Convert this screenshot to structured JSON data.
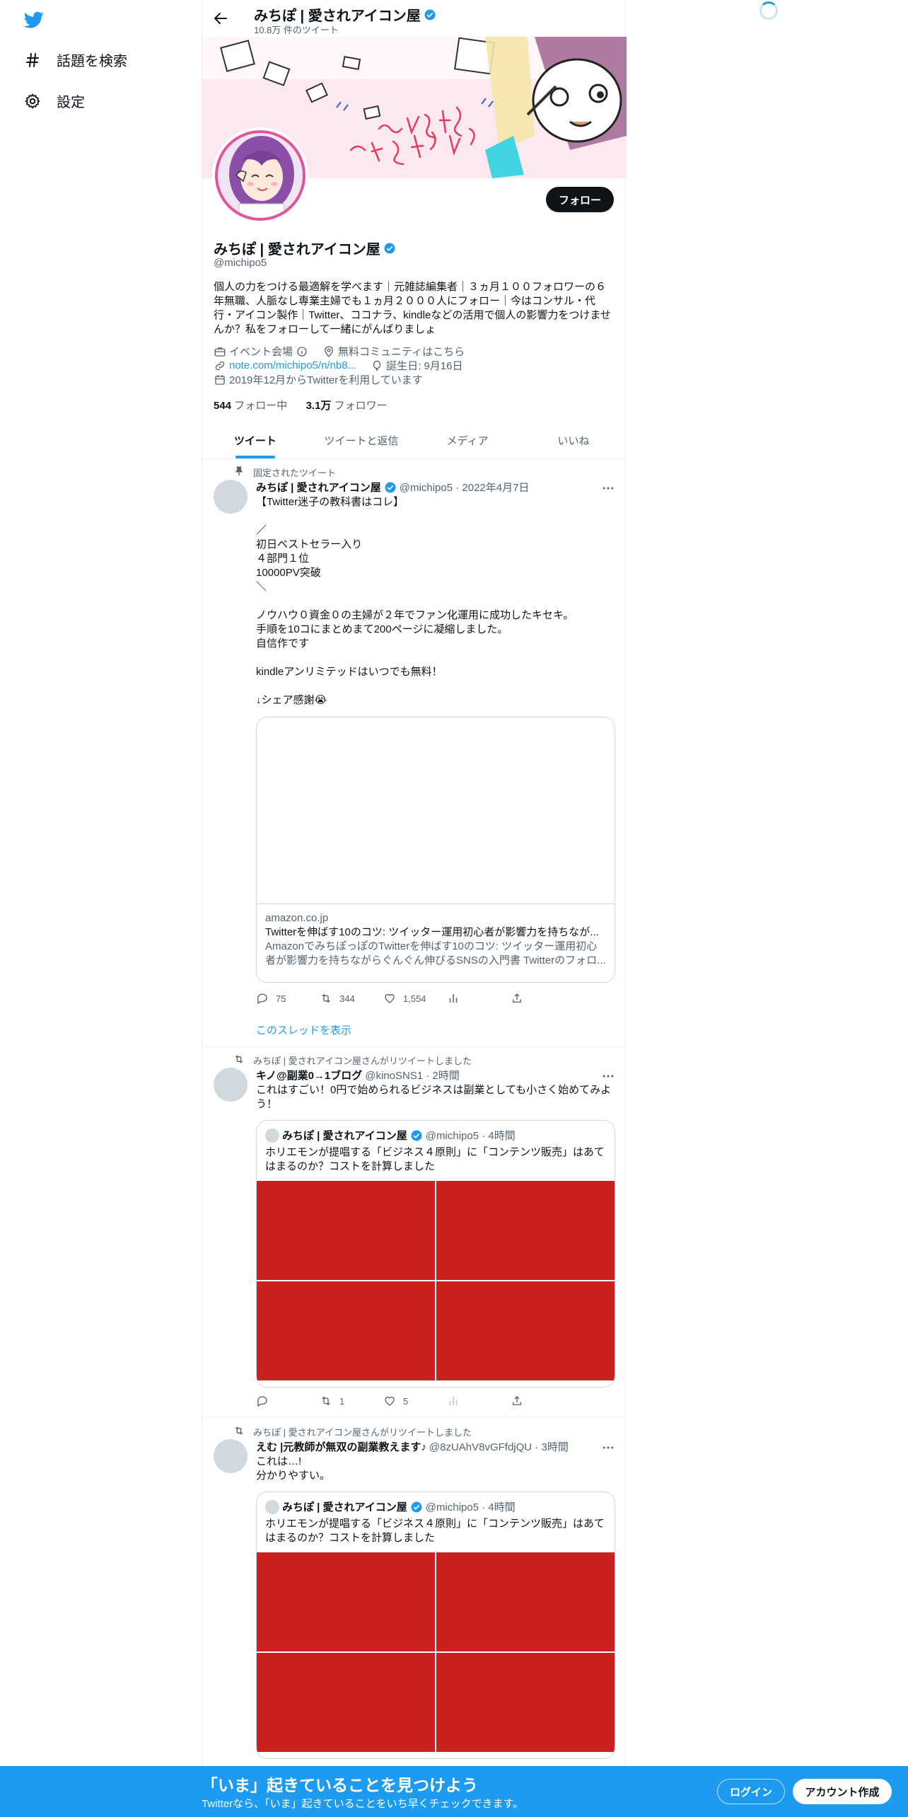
{
  "nav": {
    "explore_label": "話題を検索",
    "settings_label": "設定"
  },
  "header": {
    "name": "みちぽ | 愛されアイコン屋",
    "tweet_count": "10.8万 件のツイート"
  },
  "profile": {
    "name": "みちぽ | 愛されアイコン屋",
    "handle": "@michipo5",
    "follow_label": "フォロー",
    "bio": "個人の力をつける最適解を学べます｜元雑誌編集者｜３ヵ月１００フォロワーの６年無職、人脈なし専業主婦でも１ヵ月２０００人にフォロー｜今はコンサル・代行・アイコン製作｜Twitter、ココナラ、kindleなどの活用で個人の影響力をつけませんか？私をフォローして一緒にがんばりましょ",
    "category": "イベント会場",
    "location": "無料コミュニティはこちら",
    "link": "note.com/michipo5/n/nb8...",
    "birthday": "誕生日: 9月16日",
    "joined": "2019年12月からTwitterを利用しています",
    "following_count": "544",
    "following_label": "フォロー中",
    "followers_count": "3.1万",
    "followers_label": "フォロワー"
  },
  "tabs": [
    {
      "label": "ツイート"
    },
    {
      "label": "ツイートと返信"
    },
    {
      "label": "メディア"
    },
    {
      "label": "いいね"
    }
  ],
  "tweets": [
    {
      "context": "固定されたツイート",
      "name": "みちぽ | 愛されアイコン屋",
      "handle_time": "@michipo5 · 2022年4月7日",
      "text": "【Twitter迷子の教科書はコレ】\n\n／\n初日ベストセラー入り\n４部門１位\n10000PV突破\n＼\n\nノウハウ０資金０の主婦が２年でファン化運用に成功したキセキ。\n手順を10コにまとめまて200ページに凝縮しました。\n自信作です\n\nkindleアンリミテッドはいつでも無料！\n\n↓シェア感謝😭",
      "card": {
        "domain": "amazon.co.jp",
        "title": "Twitterを伸ばす10のコツ: ツイッター運用初心者が影響力を持ちなが...",
        "description": "AmazonでみちぽっぽのTwitterを伸ばす10のコツ: ツイッター運用初心者が影響力を持ちながらぐんぐん伸びるSNSの入門書 Twitterのフォロ..."
      },
      "replies": "75",
      "retweets": "344",
      "likes": "1,554",
      "show_thread": "このスレッドを表示"
    },
    {
      "context": "みちぽ | 愛されアイコン屋さんがリツイートしました",
      "name": "キノ@副業0→1ブログ",
      "handle_time": "@kinoSNS1 · 2時間",
      "text": "これはすごい！0円で始められるビジネスは副業としても小さく始めてみよう！",
      "quote": {
        "name": "みちぽ | 愛されアイコン屋",
        "handle_time": "@michipo5 · 4時間",
        "text": "ホリエモンが提唱する「ビジネス４原則」に「コンテンツ販売」はあてはまるのか？コストを計算しました"
      },
      "replies": "",
      "retweets": "1",
      "likes": "5"
    },
    {
      "context": "みちぽ | 愛されアイコン屋さんがリツイートしました",
      "name": "えむ |元教師が無双の副業教えます♪",
      "handle_time": "@8zUAhV8vGFfdjQU · 3時間",
      "text": "これは…!\n分かりやすい。",
      "quote": {
        "name": "みちぽ | 愛されアイコン屋",
        "handle_time": "@michipo5 · 4時間",
        "text": "ホリエモンが提唱する「ビジネス４原則」に「コンテンツ販売」はあてはまるのか？コストを計算しました"
      }
    }
  ],
  "bottom_bar": {
    "title": "「いま」起きていることを見つけよう",
    "subtitle": "Twitterなら、「いま」起きていることをいち早くチェックできます。",
    "login_label": "ログイン",
    "signup_label": "アカウント作成"
  },
  "colors": {
    "accent": "#1d9bf0",
    "text": "#0f1419",
    "muted": "#536471",
    "media_placeholder": "#cc2020"
  }
}
